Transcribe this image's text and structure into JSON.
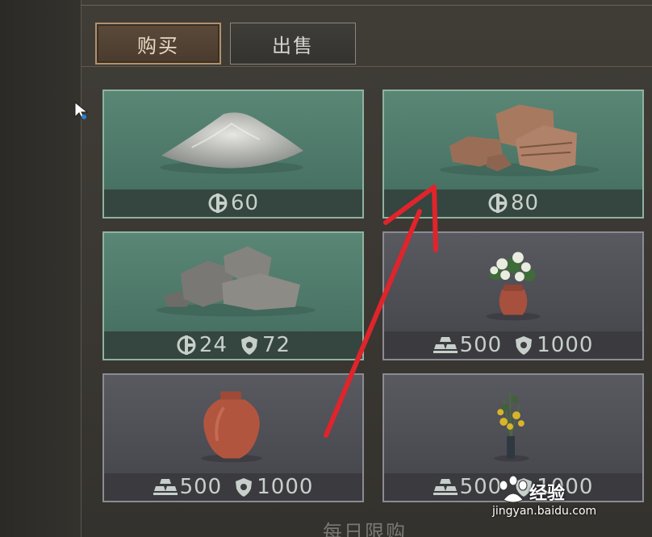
{
  "tabs": {
    "buy_label": "购买",
    "sell_label": "出售"
  },
  "items": [
    {
      "name": "sand",
      "theme": "green",
      "prices": [
        {
          "currency": "coin-icon",
          "amount": "60"
        }
      ]
    },
    {
      "name": "red-stones",
      "theme": "green",
      "prices": [
        {
          "currency": "coin-icon",
          "amount": "80"
        }
      ]
    },
    {
      "name": "gray-stones",
      "theme": "green",
      "prices": [
        {
          "currency": "coin-icon",
          "amount": "24"
        },
        {
          "currency": "shield-icon",
          "amount": "72"
        }
      ]
    },
    {
      "name": "flower-vase",
      "theme": "gray",
      "prices": [
        {
          "currency": "gold-bars-icon",
          "amount": "500"
        },
        {
          "currency": "shield-icon",
          "amount": "1000"
        }
      ]
    },
    {
      "name": "clay-jar",
      "theme": "gray",
      "prices": [
        {
          "currency": "gold-bars-icon",
          "amount": "500"
        },
        {
          "currency": "shield-icon",
          "amount": "1000"
        }
      ]
    },
    {
      "name": "sunflower-vase",
      "theme": "gray",
      "prices": [
        {
          "currency": "gold-bars-icon",
          "amount": "500"
        },
        {
          "currency": "shield-icon",
          "amount": "1000"
        }
      ]
    }
  ],
  "footer": {
    "daily_limit_label": "每日限购"
  },
  "watermark": {
    "brand": "经验",
    "url": "jingyan.baidu.com"
  },
  "colors": {
    "annotation_arrow": "#e0242b",
    "buy_tab_border": "#b3916c"
  }
}
